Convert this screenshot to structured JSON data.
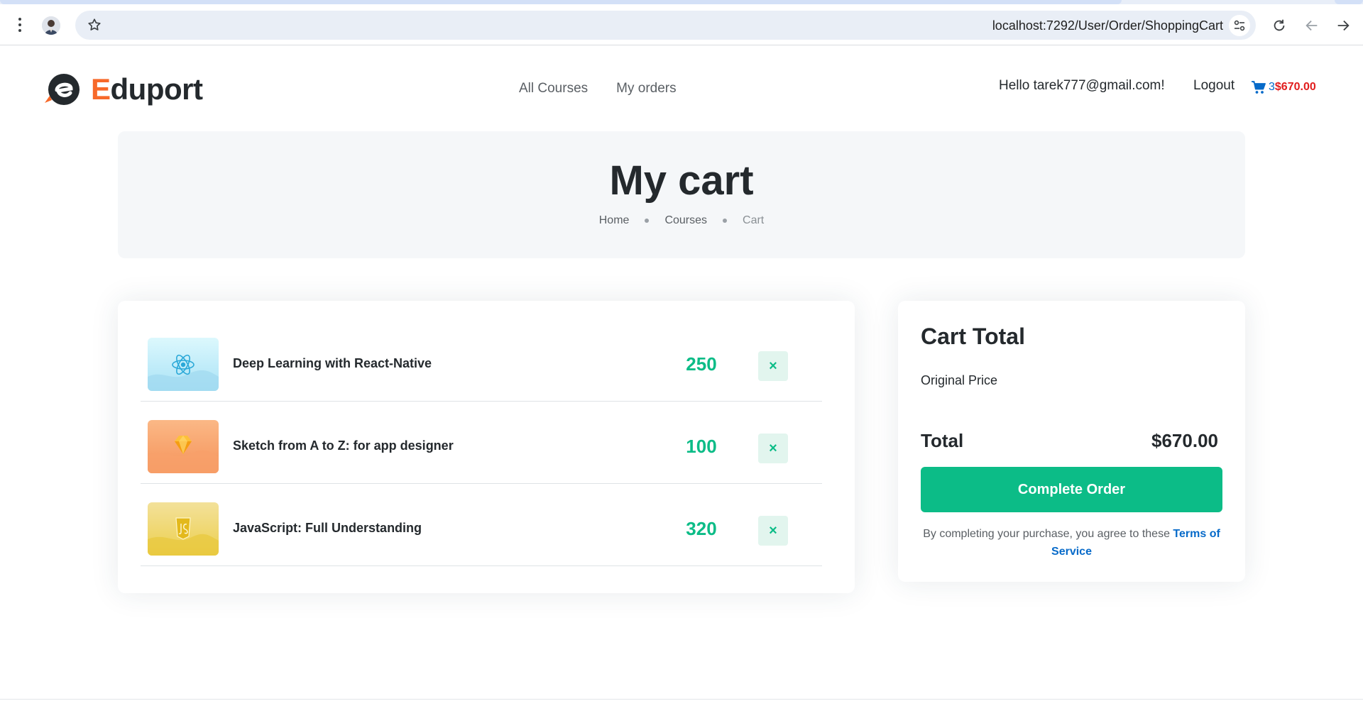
{
  "browser": {
    "url": "localhost:7292/User/Order/ShoppingCart",
    "icons": [
      "more-vert-icon",
      "profile-avatar",
      "bookmark-star-icon",
      "site-settings-icon",
      "reload-icon",
      "back-arrow-icon",
      "forward-arrow-icon"
    ]
  },
  "header": {
    "logo": {
      "first_letter": "E",
      "rest": "duport",
      "accent_color": "#f7692a"
    },
    "nav": [
      {
        "label": "All Courses"
      },
      {
        "label": "My orders"
      }
    ],
    "greeting": "Hello tarek777@gmail.com!",
    "logout_label": "Logout",
    "cart": {
      "icon": "cart-icon",
      "count": "3",
      "amount": "$670.00"
    }
  },
  "page": {
    "title": "My cart",
    "breadcrumb": [
      {
        "label": "Home"
      },
      {
        "label": "Courses"
      },
      {
        "label": "Cart"
      }
    ]
  },
  "cart": {
    "items": [
      {
        "title": "Deep Learning with React-Native",
        "price": "250",
        "remove_icon": "close-icon",
        "thumb": "react-icon",
        "thumb_color": "#bff0fb"
      },
      {
        "title": "Sketch from A to Z: for app designer",
        "price": "100",
        "remove_icon": "close-icon",
        "thumb": "sketch-diamond-icon",
        "thumb_color": "#f9a872"
      },
      {
        "title": "JavaScript: Full Understanding",
        "price": "320",
        "remove_icon": "close-icon",
        "thumb": "js-shield-icon",
        "thumb_color": "#f0d762"
      }
    ]
  },
  "summary": {
    "heading": "Cart Total",
    "original_price_label": "Original Price",
    "total_label": "Total",
    "total_value": "$670.00",
    "button_label": "Complete Order",
    "terms_text": "By completing your purchase, you agree to these ",
    "terms_link": "Terms of Service"
  },
  "colors": {
    "primary_green": "#0cbc87",
    "link_blue": "#066ac9",
    "price_red": "#e11d1d"
  },
  "remove_glyph": "×"
}
